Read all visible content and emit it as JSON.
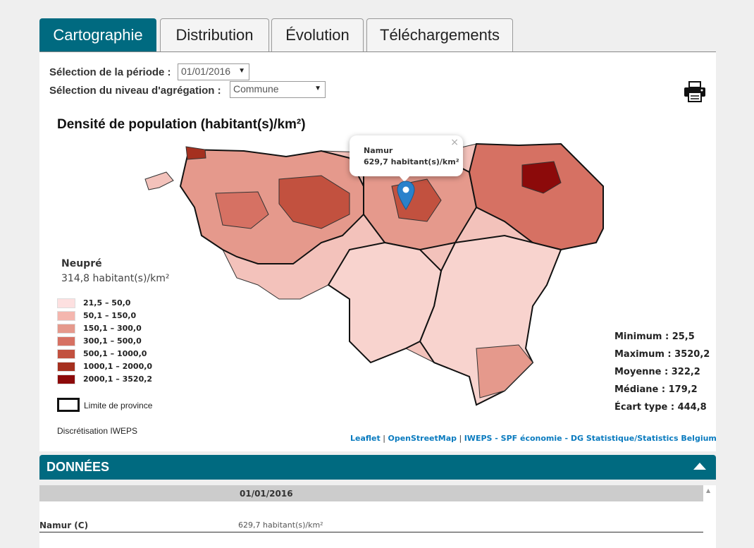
{
  "tabs": [
    {
      "label": "Cartographie",
      "active": true
    },
    {
      "label": "Distribution",
      "active": false
    },
    {
      "label": "Évolution",
      "active": false
    },
    {
      "label": "Téléchargements",
      "active": false
    }
  ],
  "controls": {
    "period_label": "Sélection de la période :",
    "period_value": "01/01/2016",
    "level_label": "Sélection du niveau d'agrégation :",
    "level_value": "Commune"
  },
  "map": {
    "title": "Densité de population (habitant(s)/km²)",
    "hover_name": "Neupré",
    "hover_value": "314,8 habitant(s)/km²",
    "popup": {
      "name": "Namur",
      "value": "629,7 habitant(s)/km²",
      "close": "×"
    },
    "legend": [
      {
        "label": "21,5 – 50,0",
        "color": "#fde0e0"
      },
      {
        "label": "50,1 – 150,0",
        "color": "#f4b6ae"
      },
      {
        "label": "150,1 – 300,0",
        "color": "#e5998c"
      },
      {
        "label": "300,1 – 500,0",
        "color": "#d67163"
      },
      {
        "label": "500,1 – 1000,0",
        "color": "#c2513f"
      },
      {
        "label": "1000,1 – 2000,0",
        "color": "#a5301f"
      },
      {
        "label": "2000,1 – 3520,2",
        "color": "#8c0a0a"
      }
    ],
    "province_label": "Limite de province",
    "discretisation": "Discrétisation IWEPS",
    "stats": [
      "Minimum : 25,5",
      "Maximum : 3520,2",
      "Moyenne : 322,2",
      "Médiane : 179,2",
      "Écart type : 444,8"
    ],
    "attribution": {
      "leaflet": "Leaflet",
      "sep1": " | ",
      "osm": "OpenStreetMap",
      "sep2": " | ",
      "source": "IWEPS - SPF économie - DG Statistique/Statistics Belgium"
    }
  },
  "donnees": {
    "title": "DONNÉES",
    "column_date": "01/01/2016",
    "row_name": "Namur (C)",
    "row_value": "629,7 habitant(s)/km²"
  }
}
